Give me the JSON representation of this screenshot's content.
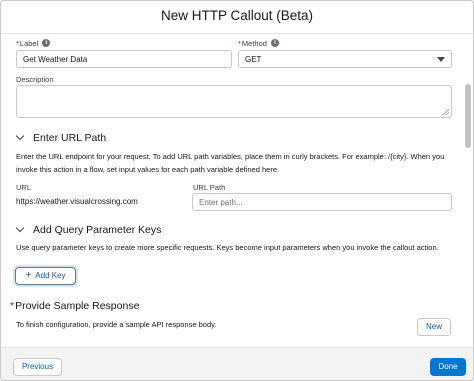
{
  "header": {
    "title": "New HTTP Callout (Beta)"
  },
  "fields": {
    "label": {
      "required_mark": "*",
      "label": "Label",
      "value": "Get Weather Data"
    },
    "method": {
      "required_mark": "*",
      "label": "Method",
      "value": "GET"
    },
    "description": {
      "label": "Description",
      "value": ""
    }
  },
  "url_section": {
    "title": "Enter URL Path",
    "help": "Enter the URL endpoint for your request. To add URL path variables, place them in curly brackets. For example: /{city}. When you invoke this action in a flow, set input values for each path variable defined here.",
    "url_label": "URL",
    "url_value": "https://weather.visualcrossing.com",
    "path_label": "URL Path",
    "path_placeholder": "Enter path..."
  },
  "query_section": {
    "title": "Add Query Parameter Keys",
    "help": "Use query parameter keys to create more specific requests. Keys become input parameters when you invoke the callout action.",
    "add_key_label": "Add Key"
  },
  "sample_section": {
    "required_mark": "*",
    "title": "Provide Sample Response",
    "help": "To finish configuration, provide a sample API response body.",
    "new_label": "New"
  },
  "footer": {
    "previous_label": "Previous",
    "done_label": "Done"
  },
  "icons": {
    "info": "info-icon",
    "select": "chevron-down-icon",
    "section": "chevron-down-icon",
    "add": "plus-icon"
  },
  "colors": {
    "brand": "#0176d3",
    "link": "#0b5cab",
    "required": "#ba0517"
  }
}
